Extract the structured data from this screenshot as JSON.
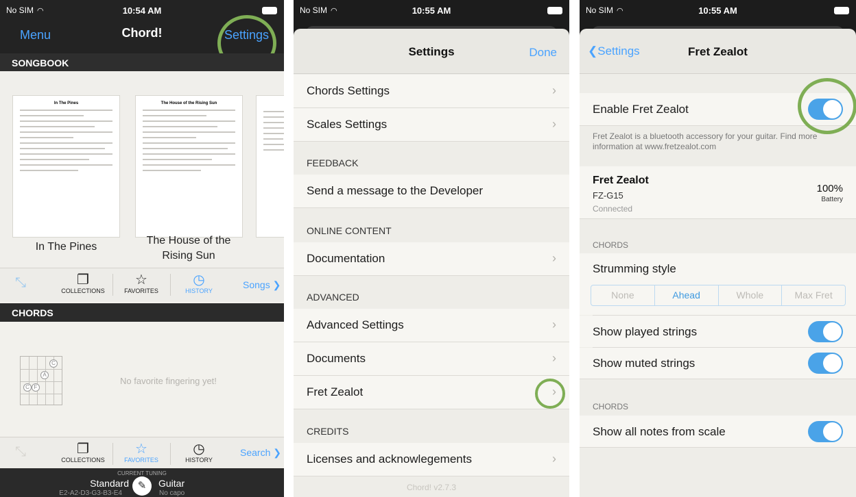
{
  "panel1": {
    "status": {
      "carrier": "No SIM",
      "time": "10:54 AM"
    },
    "nav": {
      "menu": "Menu",
      "title": "Chord!",
      "settings": "Settings"
    },
    "songbook_header": "SONGBOOK",
    "songs": [
      {
        "sheet_title": "In The Pines",
        "name": "In The Pines"
      },
      {
        "sheet_title": "The House of the Rising Sun",
        "name": "The House of the Rising Sun"
      }
    ],
    "toolbar1": {
      "collections": "COLLECTIONS",
      "favorites": "FAVORITES",
      "history": "HISTORY",
      "songs": "Songs"
    },
    "chords_header": "CHORDS",
    "fretboard_marks": [
      "C",
      "A",
      "C",
      "F"
    ],
    "no_favorite": "No favorite fingering yet!",
    "toolbar2": {
      "collections": "COLLECTIONS",
      "favorites": "FAVORITES",
      "history": "HISTORY",
      "search": "Search"
    },
    "tuning": {
      "label": "CURRENT TUNING",
      "name": "Standard",
      "instrument": "Guitar",
      "notes": "E2-A2-D3-G3-B3-E4",
      "capo": "No capo"
    }
  },
  "panel2": {
    "status": {
      "carrier": "No SIM",
      "time": "10:55 AM"
    },
    "nav": {
      "title": "Settings",
      "done": "Done"
    },
    "rows_top": [
      {
        "label": "Chords Settings"
      },
      {
        "label": "Scales Settings"
      }
    ],
    "feedback_header": "FEEDBACK",
    "send_message": "Send a message to the Developer",
    "online_header": "ONLINE CONTENT",
    "documentation": "Documentation",
    "advanced_header": "ADVANCED",
    "advanced_rows": [
      {
        "label": "Advanced Settings"
      },
      {
        "label": "Documents"
      },
      {
        "label": "Fret Zealot"
      }
    ],
    "credits_header": "CREDITS",
    "licenses": "Licenses and acknowlegements",
    "version": "Chord! v2.7.3"
  },
  "panel3": {
    "status": {
      "carrier": "No SIM",
      "time": "10:55 AM"
    },
    "nav": {
      "back": "Settings",
      "title": "Fret Zealot"
    },
    "enable_label": "Enable Fret Zealot",
    "enable_desc": "Fret Zealot is a bluetooth accessory for your guitar. Find more information at www.fretzealot.com",
    "device": {
      "name": "Fret Zealot",
      "model": "FZ-G15",
      "state": "Connected",
      "battery_value": "100%",
      "battery_label": "Battery"
    },
    "chords_header": "CHORDS",
    "strumming_label": "Strumming style",
    "strumming_options": [
      "None",
      "Ahead",
      "Whole",
      "Max Fret"
    ],
    "strumming_selected": "Ahead",
    "show_played": "Show played strings",
    "show_muted": "Show muted strings",
    "chords_header2": "CHORDS",
    "show_all_notes": "Show all notes from scale",
    "toggles": {
      "enable": true,
      "played": true,
      "muted": true,
      "all_notes": true
    },
    "toggle_color": "#4aa3e8"
  }
}
